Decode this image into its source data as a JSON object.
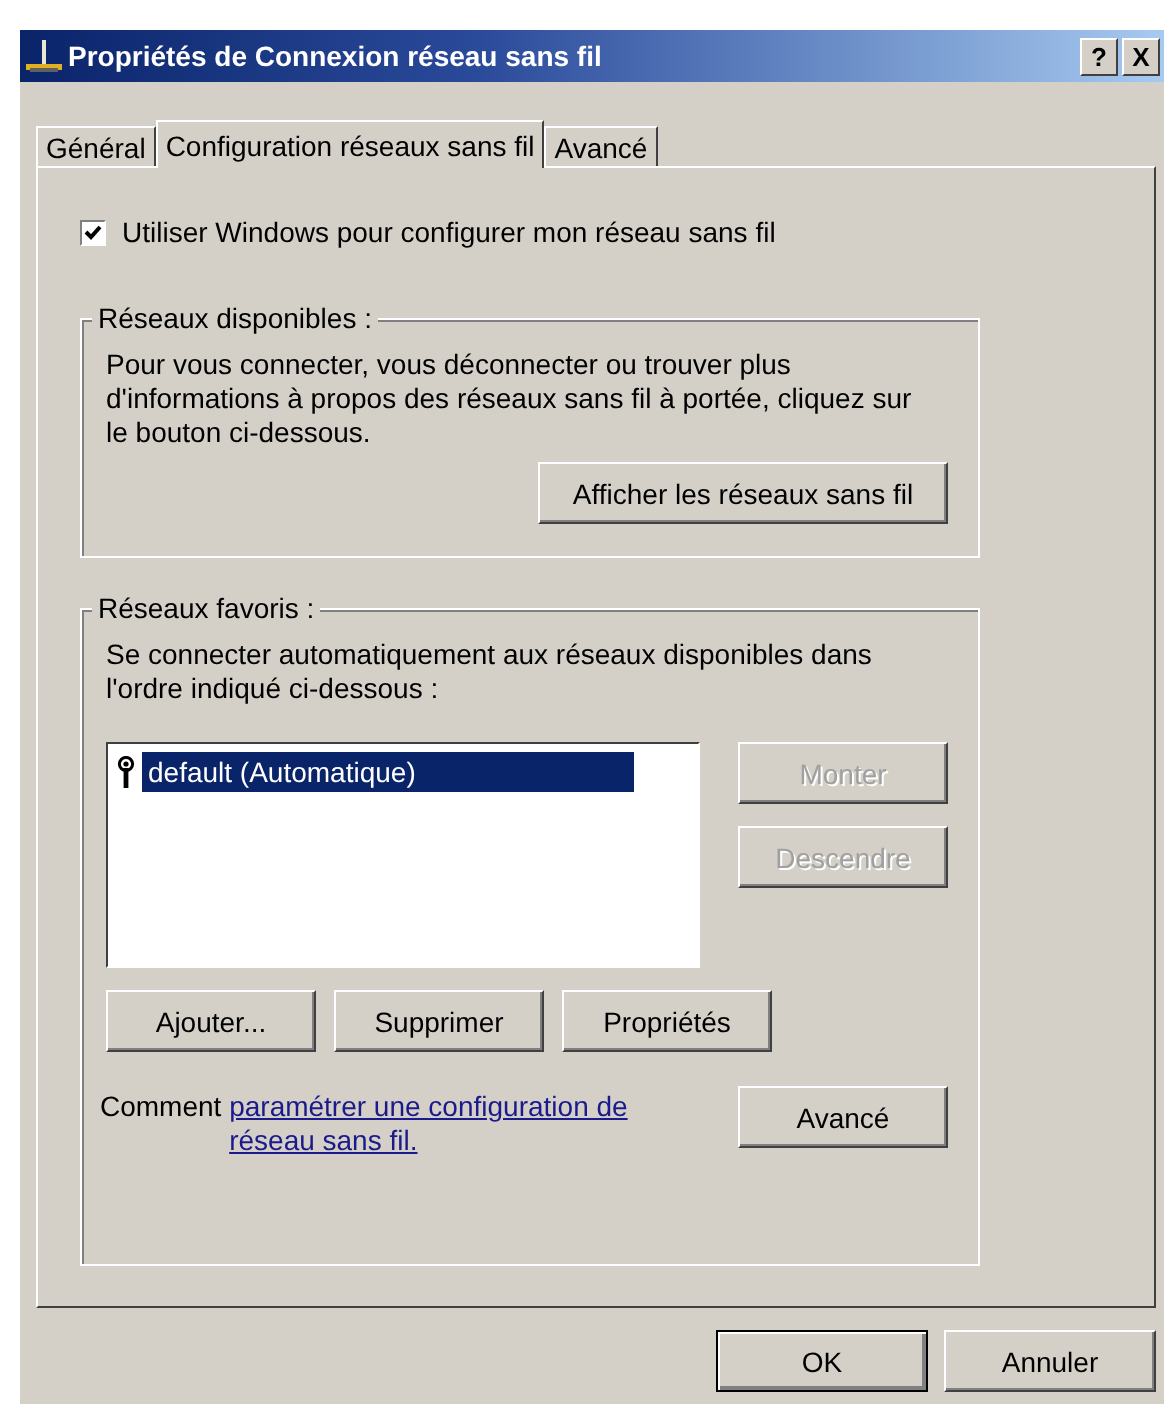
{
  "window": {
    "title": "Propriétés de Connexion réseau sans fil",
    "buttons": [
      "?",
      "X"
    ]
  },
  "tabs": [
    {
      "label": "Général",
      "selected": false
    },
    {
      "label": "Configuration réseaux sans fil",
      "selected": true
    },
    {
      "label": "Avancé",
      "selected": false
    }
  ],
  "use_windows": {
    "label": "Utiliser Windows pour configurer mon réseau sans fil",
    "checked": true
  },
  "available": {
    "title": "Réseaux disponibles :",
    "text": "Pour vous connecter, vous déconnecter ou trouver plus d'informations à propos des réseaux sans fil à portée, cliquez sur le bouton ci-dessous.",
    "button": "Afficher les réseaux sans fil"
  },
  "preferred": {
    "title": "Réseaux favoris :",
    "text": "Se connecter automatiquement aux réseaux disponibles dans l'ordre indiqué ci-dessous :",
    "networks": [
      {
        "label": "default (Automatique)",
        "selected": true
      }
    ],
    "side_buttons": [
      {
        "label": "Monter",
        "disabled": true
      },
      {
        "label": "Descendre",
        "disabled": true
      }
    ],
    "buttons": [
      {
        "label": "Ajouter...",
        "disabled": false
      },
      {
        "label": "Supprimer",
        "disabled": false
      },
      {
        "label": "Propriétés",
        "disabled": false
      }
    ],
    "help_prefix": "Comment",
    "help_link": "paramétrer une configuration de réseau sans fil.",
    "advanced_button": "Avancé"
  },
  "dialog_buttons": [
    {
      "label": "OK",
      "default": true
    },
    {
      "label": "Annuler",
      "default": false
    }
  ]
}
